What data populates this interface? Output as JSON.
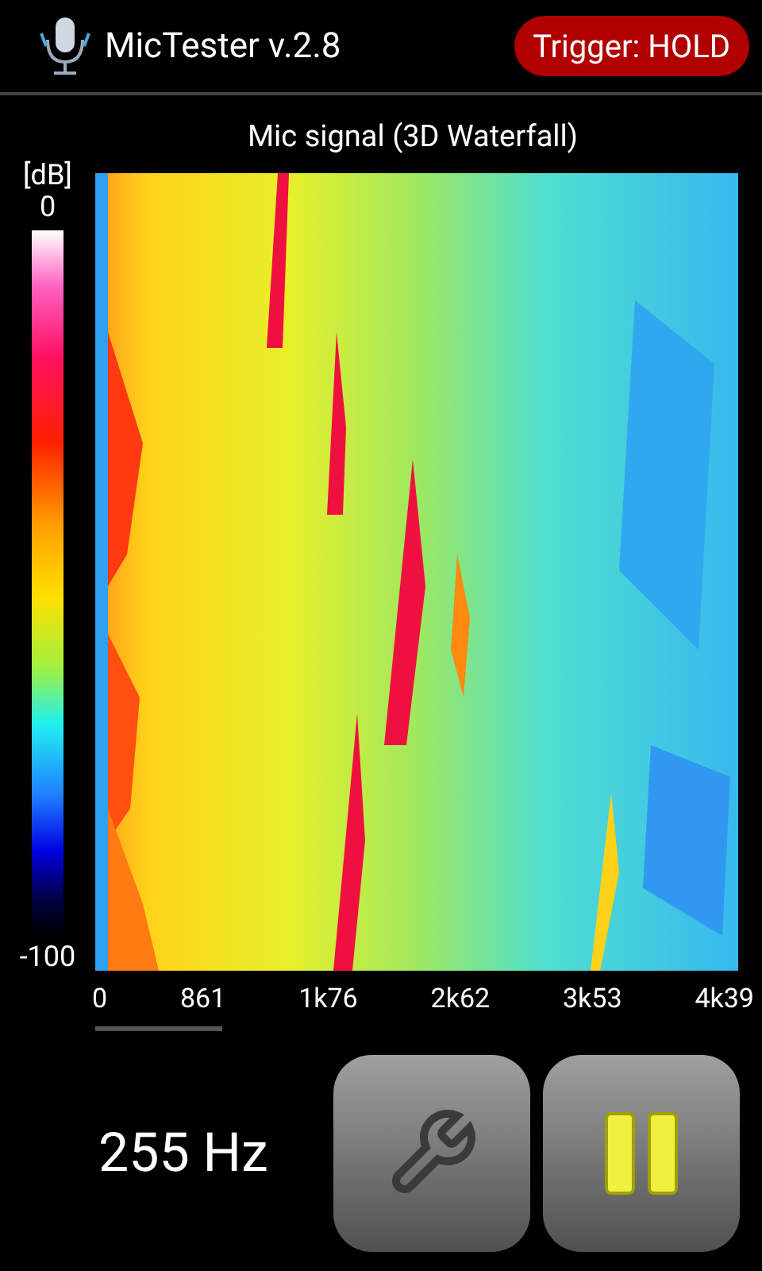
{
  "header": {
    "title": "MicTester v.2.8",
    "trigger": "Trigger: HOLD"
  },
  "chart": {
    "title": "Mic signal (3D Waterfall)",
    "scale_unit": "[dB]",
    "scale_max": "0",
    "scale_min": "-100",
    "x_labels": [
      "0",
      "861",
      "1k76",
      "2k62",
      "3k53",
      "4k39"
    ]
  },
  "readout": "255 Hz"
}
